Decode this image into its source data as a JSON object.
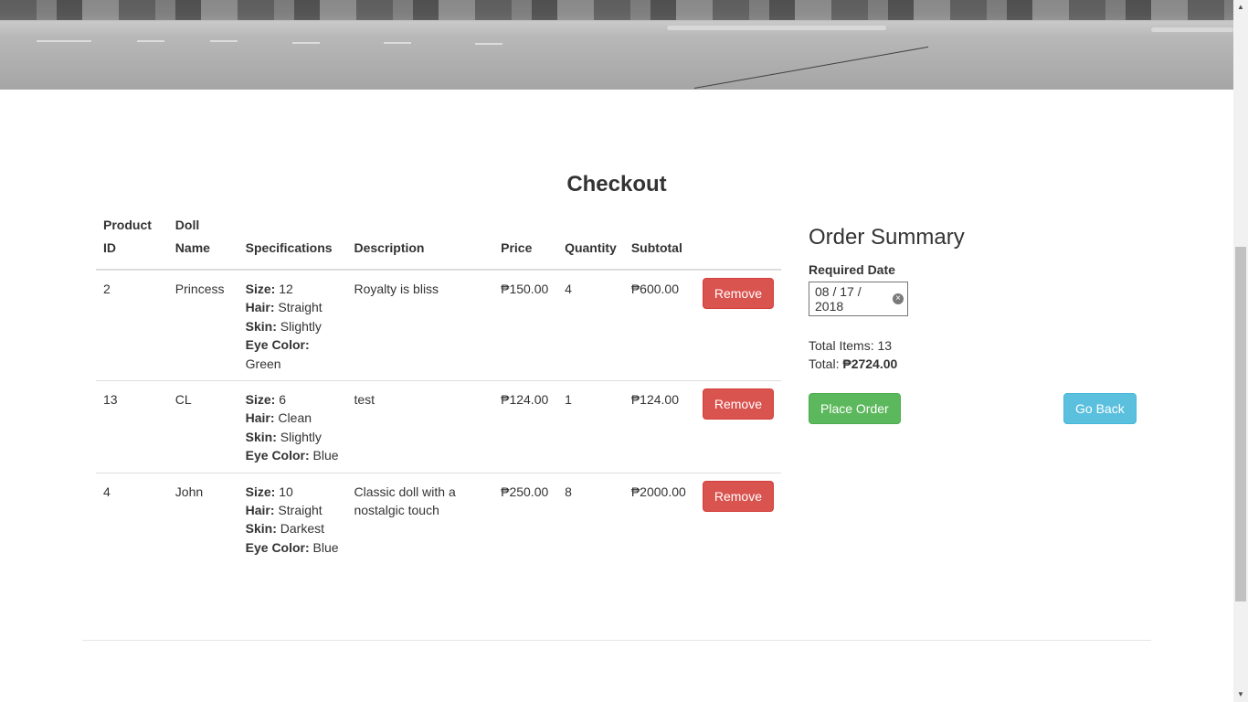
{
  "page": {
    "title": "Checkout"
  },
  "table": {
    "headers": {
      "product_id": "Product ID",
      "doll_name": "Doll Name",
      "specifications": "Specifications",
      "description": "Description",
      "price": "Price",
      "quantity": "Quantity",
      "subtotal": "Subtotal"
    },
    "rows": [
      {
        "product_id": "2",
        "doll_name": "Princess",
        "specs": [
          {
            "label": "Size:",
            "value": " 12"
          },
          {
            "label": "Hair:",
            "value": " Straight"
          },
          {
            "label": "Skin:",
            "value": " Slightly"
          },
          {
            "label": "Eye Color:",
            "value": " Green"
          }
        ],
        "description": "Royalty is bliss",
        "price": "₱150.00",
        "quantity": "4",
        "subtotal": "₱600.00",
        "remove_label": "Remove"
      },
      {
        "product_id": "13",
        "doll_name": "CL",
        "specs": [
          {
            "label": "Size:",
            "value": " 6"
          },
          {
            "label": "Hair:",
            "value": " Clean"
          },
          {
            "label": "Skin:",
            "value": " Slightly"
          },
          {
            "label": "Eye Color:",
            "value": " Blue"
          }
        ],
        "description": "test",
        "price": "₱124.00",
        "quantity": "1",
        "subtotal": "₱124.00",
        "remove_label": "Remove"
      },
      {
        "product_id": "4",
        "doll_name": "John",
        "specs": [
          {
            "label": "Size:",
            "value": " 10"
          },
          {
            "label": "Hair:",
            "value": " Straight"
          },
          {
            "label": "Skin:",
            "value": " Darkest"
          },
          {
            "label": "Eye Color:",
            "value": " Blue"
          }
        ],
        "description": "Classic doll with a nostalgic touch",
        "price": "₱250.00",
        "quantity": "8",
        "subtotal": "₱2000.00",
        "remove_label": "Remove"
      }
    ]
  },
  "summary": {
    "heading": "Order Summary",
    "date_label": "Required Date",
    "date_value": "08 / 17 / 2018",
    "total_items_label": "Total Items: ",
    "total_items": "13",
    "total_label": "Total: ",
    "total_value": "₱2724.00",
    "place_order_label": "Place Order",
    "go_back_label": "Go Back"
  },
  "colors": {
    "danger": "#d9534f",
    "success": "#5cb85c",
    "info": "#5bc0de"
  },
  "icons": {
    "date_clear": "clear-circle-icon",
    "scroll_up": "arrow-up-icon",
    "scroll_down": "arrow-down-icon"
  }
}
